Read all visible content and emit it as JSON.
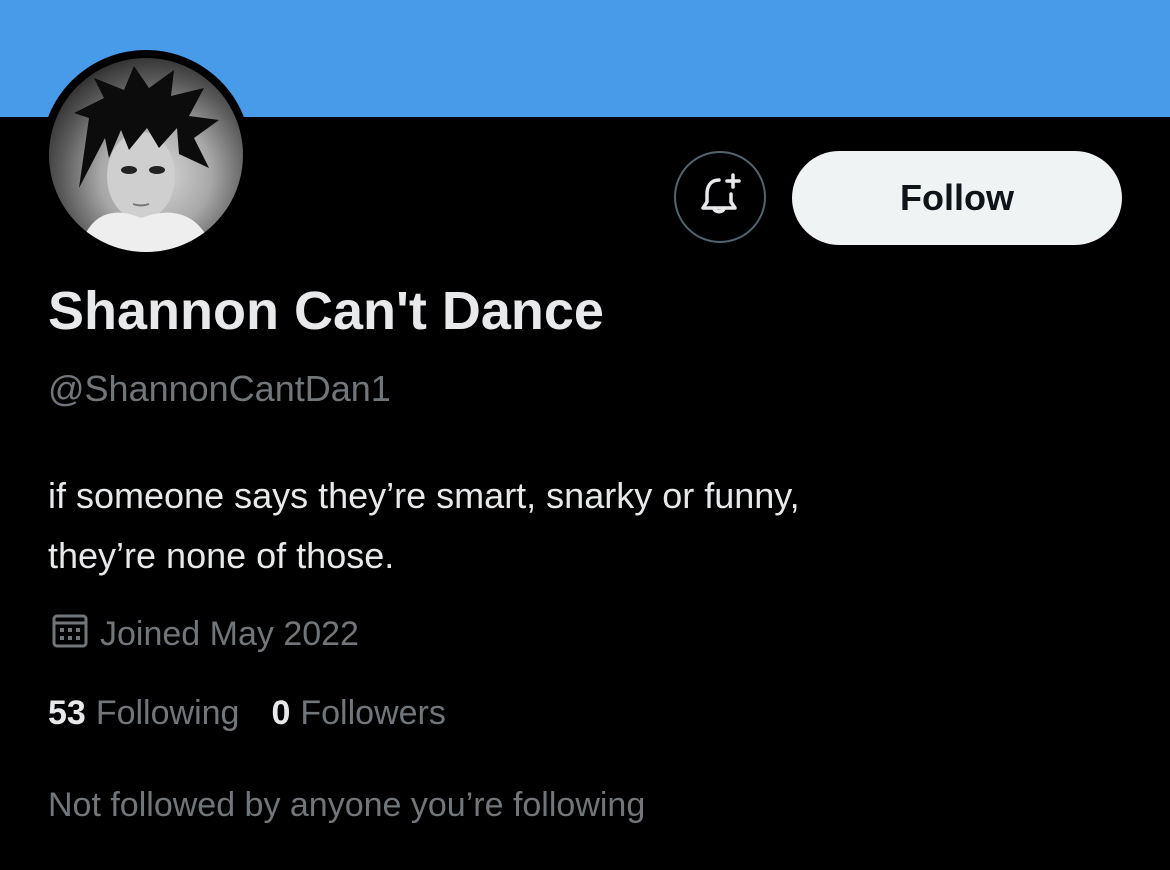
{
  "profile": {
    "display_name": "Shannon Can't Dance",
    "handle": "@ShannonCantDan1",
    "bio_lines": [
      "if someone says they’re smart, snarky or funny,",
      "they’re none of those."
    ],
    "joined": "Joined May 2022",
    "following_count": "53",
    "following_label": "Following",
    "followers_count": "0",
    "followers_label": "Followers",
    "mutuals_text": "Not followed by anyone you’re following"
  },
  "actions": {
    "follow_label": "Follow",
    "notify_icon": "bell-plus-icon"
  },
  "icons": {
    "joined_icon": "calendar-icon"
  },
  "colors": {
    "banner": "#479be8",
    "background": "#000000",
    "primary_text": "#e7e9ea",
    "secondary_text": "#71767b",
    "follow_button_bg": "#eff3f4"
  }
}
